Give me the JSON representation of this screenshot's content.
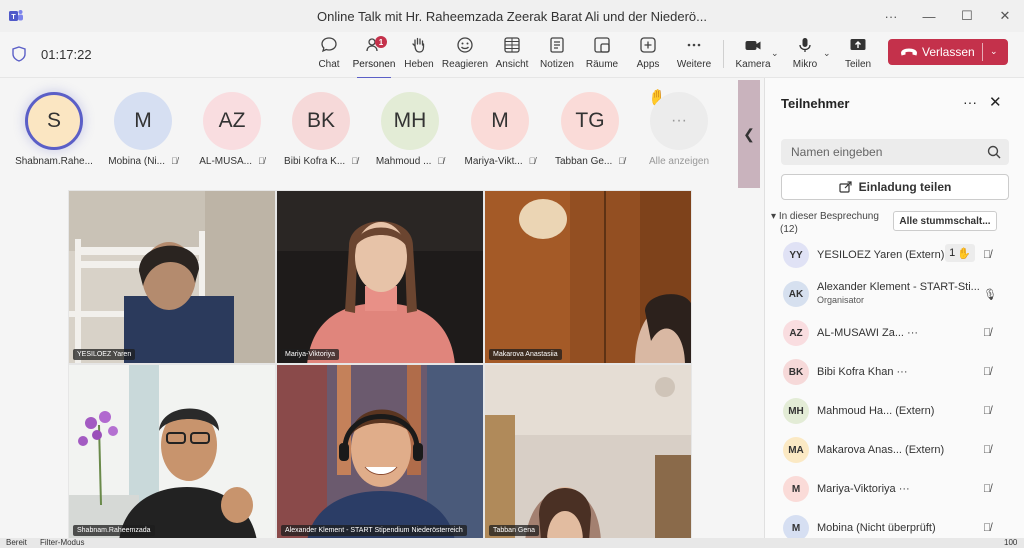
{
  "window": {
    "title": "Online Talk mit Hr. Raheemzada Zeerak Barat Ali und der Niederö...",
    "more": "···",
    "minimize": "—",
    "maximize": "☐",
    "close": "✕"
  },
  "toolbar": {
    "timer": "01:17:22",
    "items": [
      {
        "label": "Chat",
        "icon": "chat-icon"
      },
      {
        "label": "Personen",
        "icon": "people-icon",
        "badge": "1",
        "active": true
      },
      {
        "label": "Heben",
        "icon": "raise-hand-icon"
      },
      {
        "label": "Reagieren",
        "icon": "smiley-icon"
      },
      {
        "label": "Ansicht",
        "icon": "grid-view-icon"
      },
      {
        "label": "Notizen",
        "icon": "notes-icon"
      },
      {
        "label": "Räume",
        "icon": "rooms-icon"
      },
      {
        "label": "Apps",
        "icon": "apps-icon"
      },
      {
        "label": "Weitere",
        "icon": "more-icon"
      }
    ],
    "camera_label": "Kamera",
    "mic_label": "Mikro",
    "share_label": "Teilen",
    "leave_label": "Verlassen"
  },
  "strip": {
    "avatars": [
      {
        "initials": "S",
        "name": "Shabnam.Rahe...",
        "color": "#fbe6c2",
        "muted": false,
        "ring": true
      },
      {
        "initials": "M",
        "name": "Mobina (Ni...",
        "color": "#d6dff2",
        "muted": true
      },
      {
        "initials": "AZ",
        "name": "AL-MUSA...",
        "color": "#f9dde0",
        "muted": true
      },
      {
        "initials": "BK",
        "name": "Bibi Kofra K...",
        "color": "#f6d9d9",
        "muted": true
      },
      {
        "initials": "MH",
        "name": "Mahmoud ...",
        "color": "#e3ecd6",
        "muted": true
      },
      {
        "initials": "M",
        "name": "Mariya-Vikt...",
        "color": "#fadbd8",
        "muted": true
      },
      {
        "initials": "TG",
        "name": "Tabban Ge...",
        "color": "#fadbd8",
        "muted": true
      }
    ],
    "show_all": "Alle anzeigen",
    "show_all_icon": "···"
  },
  "tiles": [
    {
      "name": "YESILOEZ Yaren"
    },
    {
      "name": "Mariya-Viktoriya"
    },
    {
      "name": "Makarova Anastasiia"
    },
    {
      "name": "Shabnam.Raheemzada"
    },
    {
      "name": "Alexander Klement - START Stipendium Niederösterreich"
    },
    {
      "name": "Tabban Gena"
    }
  ],
  "panel": {
    "title": "Teilnehmer",
    "more": "···",
    "search_placeholder": "Namen eingeben",
    "invite_label": "Einladung teilen",
    "section_label": "In dieser Besprechung",
    "section_count": "(12)",
    "mute_all": "Alle stummschalt...",
    "people": [
      {
        "initials": "YY",
        "name": "YESILOEZ Yaren (Extern)",
        "color": "#e0e2f5",
        "hand_count": "1",
        "mic": "muted"
      },
      {
        "initials": "AK",
        "name": "Alexander Klement - START-Sti...",
        "role": "Organisator",
        "color": "#d6e0ef",
        "mic": "on"
      },
      {
        "initials": "AZ",
        "name": "AL-MUSAWI Za... ···",
        "color": "#f9dde0",
        "mic": "muted"
      },
      {
        "initials": "BK",
        "name": "Bibi Kofra Khan ···",
        "color": "#f6d9d9",
        "mic": "muted"
      },
      {
        "initials": "MH",
        "name": "Mahmoud Ha...   (Extern)",
        "color": "#e3ecd6",
        "mic": "muted"
      },
      {
        "initials": "MA",
        "name": "Makarova Anas... (Extern)",
        "color": "#fbe9c4",
        "mic": "muted"
      },
      {
        "initials": "M",
        "name": "Mariya-Viktoriya ···",
        "color": "#fadbd8",
        "mic": "muted"
      },
      {
        "initials": "M",
        "name": "Mobina (Nicht überprüft)",
        "color": "#d6dff2",
        "mic": "muted"
      }
    ]
  },
  "status": {
    "left": "Bereit",
    "mode": "Filter-Modus",
    "zoom": "100"
  },
  "colors": {
    "accent": "#5b5fc7",
    "leave": "#c4314b",
    "badge": "#c4314b"
  }
}
